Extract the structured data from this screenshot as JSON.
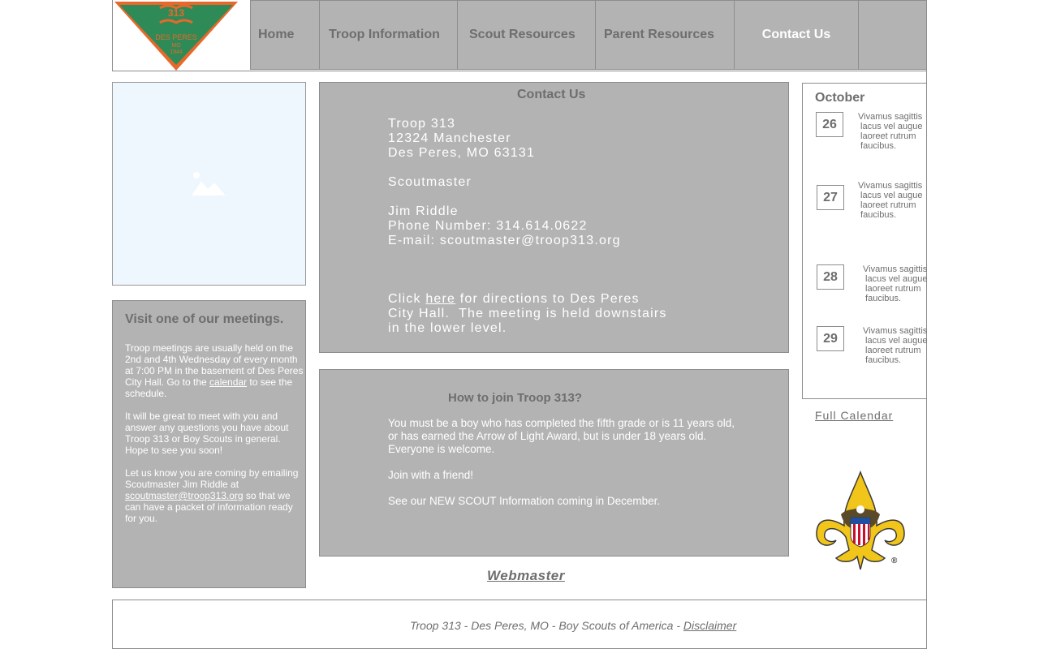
{
  "logo": {
    "text_top": "313",
    "text_city": "DES PERES",
    "text_state": "MO",
    "text_year": "1944"
  },
  "nav": {
    "items": [
      "Home",
      "Troop Information",
      "Scout Resources",
      "Parent Resources",
      "Contact Us"
    ],
    "active": "Contact Us"
  },
  "meetings": {
    "title": "Visit one of our meetings.",
    "p1_before": "Troop meetings are usually held on the 2nd and 4th Wednesday of every month at 7:00 PM in the basement of Des Peres City Hall.  Go to the ",
    "p1_link": "calendar",
    "p1_after": " to see the schedule.",
    "p2": "It will be great to meet with you and answer any questions you have about Troop 313 or Boy Scouts in general.  Hope to see you soon!",
    "p3_before": "Let us know you are coming by emailing Scoutmaster Jim Riddle at ",
    "p3_link": "scoutmaster@troop313.org",
    "p3_after": " so that we can have a packet of information ready for you."
  },
  "contact": {
    "title": "Contact Us",
    "address_line1": "Troop 313",
    "address_line2": "12324 Manchester",
    "address_line3": "Des Peres, MO 63131",
    "role": "Scoutmaster",
    "name": "Jim Riddle",
    "phone": "Phone Number: 314.614.0622",
    "email": "E-mail: scoutmaster@troop313.org",
    "directions_before": "Click ",
    "directions_link": "here",
    "directions_line1_after": " for directions to Des Peres",
    "directions_line2": "City Hall.  The meeting is held downstairs",
    "directions_line3": "in the lower level."
  },
  "join": {
    "title": "How to join Troop 313?",
    "p1": "You must be a boy who has completed the fifth grade or is 11 years old, or has earned the Arrow of Light Award, but is under 18 years old.  Everyone is welcome.",
    "p2": "Join with a friend!",
    "p3": "See our NEW SCOUT Information coming in December."
  },
  "webmaster": "Webmaster",
  "calendar": {
    "month": "October",
    "events": [
      {
        "day": "26",
        "text": "Vivamus sagittis\n lacus vel augue\n laoreet rutrum\n faucibus."
      },
      {
        "day": "27",
        "text": "Vivamus sagittis\n lacus vel augue\n laoreet rutrum\n faucibus."
      },
      {
        "day": "28",
        "text": "Vivamus sagittis\n lacus vel augue\n laoreet rutrum\n faucibus."
      },
      {
        "day": "29",
        "text": "Vivamus sagittis\n lacus vel augue\n laoreet rutrum\n faucibus."
      }
    ],
    "full_link": "Full Calendar"
  },
  "footer": {
    "text": "Troop 313 - Des Peres, MO - Boy Scouts of America - ",
    "link": "Disclaimer"
  },
  "colors": {
    "nav_bg": "#b3b3b3",
    "image_bg": "#eef6fe",
    "logo_green": "#2e8b57",
    "logo_orange": "#e8682a"
  }
}
